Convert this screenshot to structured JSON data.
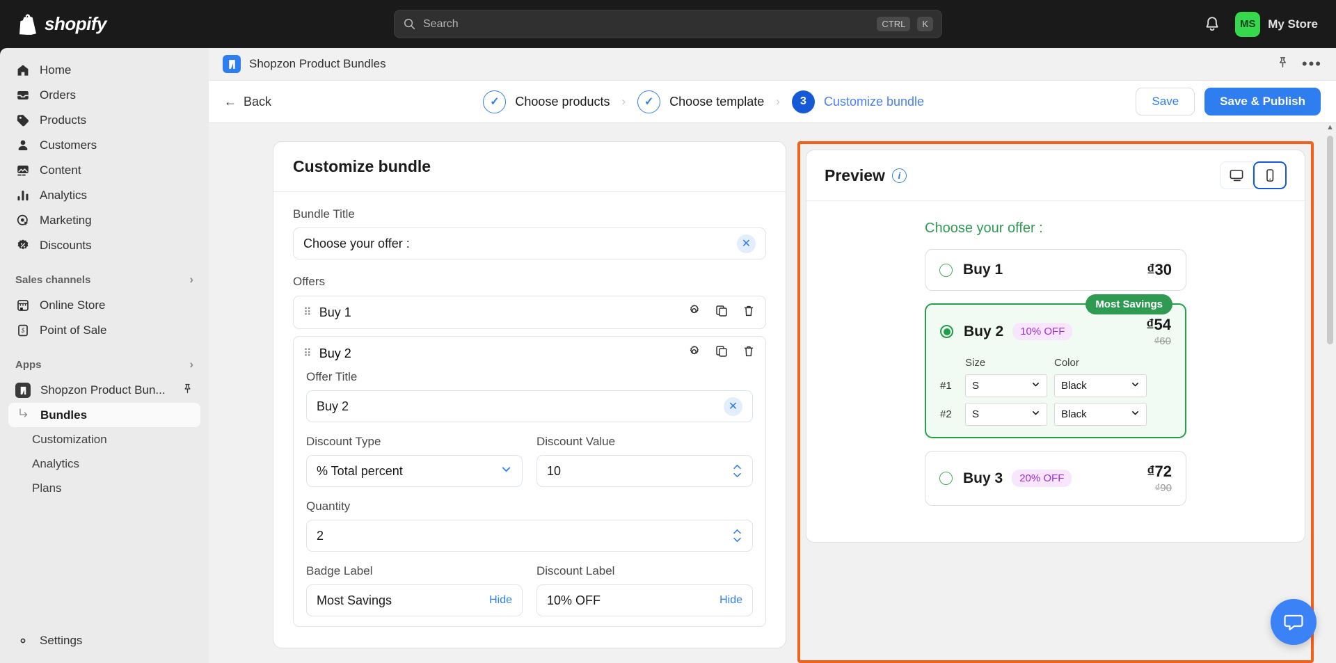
{
  "topbar": {
    "brand": "shopify",
    "search": {
      "placeholder": "Search",
      "kbd_mod": "CTRL",
      "kbd_key": "K"
    },
    "store": {
      "initials": "MS",
      "name": "My Store"
    }
  },
  "sidebar": {
    "items": [
      {
        "label": "Home",
        "icon": "home-icon"
      },
      {
        "label": "Orders",
        "icon": "orders-icon"
      },
      {
        "label": "Products",
        "icon": "products-tag-icon"
      },
      {
        "label": "Customers",
        "icon": "customers-icon"
      },
      {
        "label": "Content",
        "icon": "content-icon"
      },
      {
        "label": "Analytics",
        "icon": "analytics-bars-icon"
      },
      {
        "label": "Marketing",
        "icon": "marketing-target-icon"
      },
      {
        "label": "Discounts",
        "icon": "discounts-badge-icon"
      }
    ],
    "sales_channels": {
      "label": "Sales channels",
      "items": [
        {
          "label": "Online Store",
          "icon": "storefront-icon"
        },
        {
          "label": "Point of Sale",
          "icon": "pos-icon"
        }
      ]
    },
    "apps": {
      "label": "Apps",
      "app_name": "Shopzon Product Bun...",
      "items": [
        {
          "label": "Bundles",
          "active": true
        },
        {
          "label": "Customization",
          "active": false
        },
        {
          "label": "Analytics",
          "active": false
        },
        {
          "label": "Plans",
          "active": false
        }
      ]
    },
    "settings": {
      "label": "Settings",
      "icon": "gear-icon"
    }
  },
  "appbar": {
    "title": "Shopzon Product Bundles"
  },
  "wizard": {
    "back": "Back",
    "steps": [
      {
        "marker": "✓",
        "label": "Choose products",
        "state": "done"
      },
      {
        "marker": "✓",
        "label": "Choose template",
        "state": "done"
      },
      {
        "marker": "3",
        "label": "Customize bundle",
        "state": "current"
      }
    ],
    "save_label": "Save",
    "save_publish_label": "Save & Publish"
  },
  "customize": {
    "card_title": "Customize bundle",
    "bundle_title_label": "Bundle Title",
    "bundle_title_value": "Choose your offer :",
    "offers_label": "Offers",
    "offers": [
      {
        "name": "Buy 1",
        "expanded": false
      },
      {
        "name": "Buy 2",
        "expanded": true
      }
    ],
    "offer_title_label": "Offer Title",
    "offer_title_value": "Buy 2",
    "discount_type_label": "Discount Type",
    "discount_type_value": "% Total percent",
    "discount_value_label": "Discount Value",
    "discount_value": "10",
    "quantity_label": "Quantity",
    "quantity_value": "2",
    "badge_label_label": "Badge Label",
    "badge_label_value": "Most Savings",
    "badge_hide": "Hide",
    "discount_label_label": "Discount Label",
    "discount_label_value": "10% OFF",
    "discount_hide": "Hide"
  },
  "preview": {
    "title": "Preview",
    "info_icon": "info-icon",
    "device_desktop": "desktop-icon",
    "device_mobile": "mobile-icon",
    "selected_device": "mobile",
    "heading": "Choose your offer :",
    "offers": [
      {
        "name": "Buy 1",
        "discount_pill": "",
        "price": "₫30",
        "old_price": "",
        "selected": false,
        "badge": "",
        "variants": []
      },
      {
        "name": "Buy 2",
        "discount_pill": "10% OFF",
        "price": "₫54",
        "old_price": "₫60",
        "selected": true,
        "badge": "Most Savings",
        "variant_headers": [
          "Size",
          "Color"
        ],
        "variants": [
          {
            "num": "#1",
            "size": "S",
            "color": "Black"
          },
          {
            "num": "#2",
            "size": "S",
            "color": "Black"
          }
        ]
      },
      {
        "name": "Buy 3",
        "discount_pill": "20% OFF",
        "price": "₫72",
        "old_price": "₫90",
        "selected": false,
        "badge": "",
        "variants": []
      }
    ]
  },
  "colors": {
    "accent_blue": "#2f7ef0",
    "primary_blue": "#1559d6",
    "green": "#2e9a52",
    "purple": "#9b2fd0",
    "highlight_orange": "#f4611a",
    "shopify_green": "#36d94b"
  }
}
